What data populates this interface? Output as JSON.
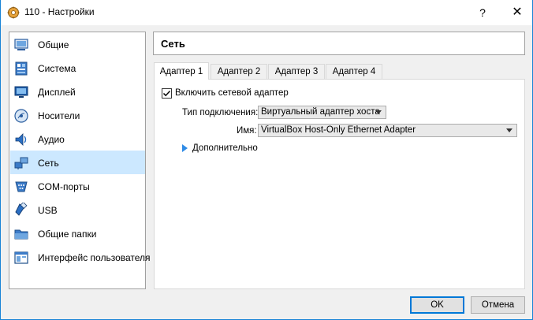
{
  "window": {
    "title": "110 - Настройки",
    "help_label": "?",
    "close_label": "✕"
  },
  "sidebar": {
    "items": [
      {
        "label": "Общие",
        "icon": "general-icon"
      },
      {
        "label": "Система",
        "icon": "system-icon"
      },
      {
        "label": "Дисплей",
        "icon": "display-icon"
      },
      {
        "label": "Носители",
        "icon": "storage-icon"
      },
      {
        "label": "Аудио",
        "icon": "audio-icon"
      },
      {
        "label": "Сеть",
        "icon": "network-icon",
        "selected": true
      },
      {
        "label": "COM-порты",
        "icon": "serial-ports-icon"
      },
      {
        "label": "USB",
        "icon": "usb-icon"
      },
      {
        "label": "Общие папки",
        "icon": "shared-folders-icon"
      },
      {
        "label": "Интерфейс пользователя",
        "icon": "user-interface-icon"
      }
    ]
  },
  "page": {
    "title": "Сеть"
  },
  "tabs": [
    {
      "label": "Адаптер 1",
      "active": true
    },
    {
      "label": "Адаптер 2"
    },
    {
      "label": "Адаптер 3"
    },
    {
      "label": "Адаптер 4"
    }
  ],
  "adapter": {
    "enable_label": "Включить сетевой адаптер",
    "enabled": true,
    "attached_to_label": "Тип подключения:",
    "attached_to_value": "Виртуальный адаптер хоста",
    "name_label": "Имя:",
    "name_value": "VirtualBox Host-Only Ethernet Adapter",
    "advanced_label": "Дополнительно"
  },
  "buttons": {
    "ok_label": "OK",
    "cancel_label": "Отмена"
  },
  "colors": {
    "selection": "#cce8ff",
    "accent": "#0078d7",
    "window_border": "#1883d7"
  }
}
